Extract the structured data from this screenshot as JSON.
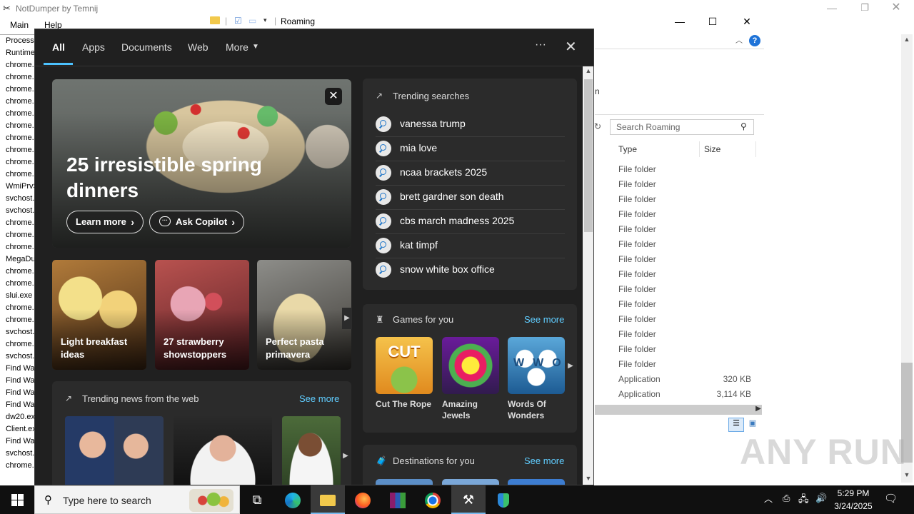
{
  "notdumper": {
    "title": "NotDumper by Temnij",
    "menu": [
      "Main",
      "Help"
    ],
    "processes": [
      "Process",
      "Runtime",
      "chrome.",
      "chrome.",
      "chrome.",
      "chrome.",
      "chrome.",
      "chrome.",
      "chrome.",
      "chrome.",
      "chrome.",
      "chrome.",
      "WmiPrvS",
      "svchost.",
      "svchost.",
      "chrome.",
      "chrome.",
      "chrome.",
      "MegaDu",
      "chrome.",
      "chrome.",
      "slui.exe",
      "chrome.",
      "chrome.",
      "svchost.",
      "chrome.",
      "svchost.",
      "Find Wa",
      "Find Wa",
      "Find Wa",
      "Find Wa",
      "dw20.ex",
      "Client.ex",
      "Find Wa",
      "svchost.",
      "chrome."
    ]
  },
  "explorer": {
    "path_title": "Roaming",
    "ribbon_fragment": "n",
    "search_placeholder": "Search Roaming",
    "columns": {
      "type": "Type",
      "size": "Size"
    },
    "rows": [
      {
        "type": "File folder",
        "size": ""
      },
      {
        "type": "File folder",
        "size": ""
      },
      {
        "type": "File folder",
        "size": ""
      },
      {
        "type": "File folder",
        "size": ""
      },
      {
        "type": "File folder",
        "size": ""
      },
      {
        "type": "File folder",
        "size": ""
      },
      {
        "type": "File folder",
        "size": ""
      },
      {
        "type": "File folder",
        "size": ""
      },
      {
        "type": "File folder",
        "size": ""
      },
      {
        "type": "File folder",
        "size": ""
      },
      {
        "type": "File folder",
        "size": ""
      },
      {
        "type": "File folder",
        "size": ""
      },
      {
        "type": "File folder",
        "size": ""
      },
      {
        "type": "File folder",
        "size": ""
      },
      {
        "type": "Application",
        "size": "320 KB"
      },
      {
        "type": "Application",
        "size": "3,114 KB"
      }
    ]
  },
  "search": {
    "tabs": {
      "all": "All",
      "apps": "Apps",
      "documents": "Documents",
      "web": "Web",
      "more": "More"
    },
    "hero": {
      "title": "25 irresistible spring dinners",
      "learn_more": "Learn more",
      "ask_copilot": "Ask Copilot"
    },
    "recipes": [
      "Light breakfast ideas",
      "27 strawberry showstoppers",
      "Perfect pasta primavera"
    ],
    "trending_searches": {
      "title": "Trending searches",
      "items": [
        "vanessa trump",
        "mia love",
        "ncaa brackets 2025",
        "brett gardner son death",
        "cbs march madness 2025",
        "kat timpf",
        "snow white box office"
      ]
    },
    "news": {
      "title": "Trending news from the web",
      "see_more": "See more"
    },
    "games": {
      "title": "Games for you",
      "see_more": "See more",
      "items": [
        "Cut The Rope",
        "Amazing Jewels",
        "Words Of Wonders"
      ],
      "tile_text_1": "CUT",
      "tile_text_3": "WWO"
    },
    "destinations": {
      "title": "Destinations for you",
      "see_more": "See more"
    }
  },
  "taskbar": {
    "search_placeholder": "Type here to search",
    "time": "5:29 PM",
    "date": "3/24/2025"
  },
  "watermark": "ANY RUN",
  "colors": {
    "accent": "#4cc2ff",
    "link": "#60cdff",
    "panel_bg": "#202020",
    "card_bg": "#2b2b2b",
    "taskbar_bg": "#101010"
  }
}
